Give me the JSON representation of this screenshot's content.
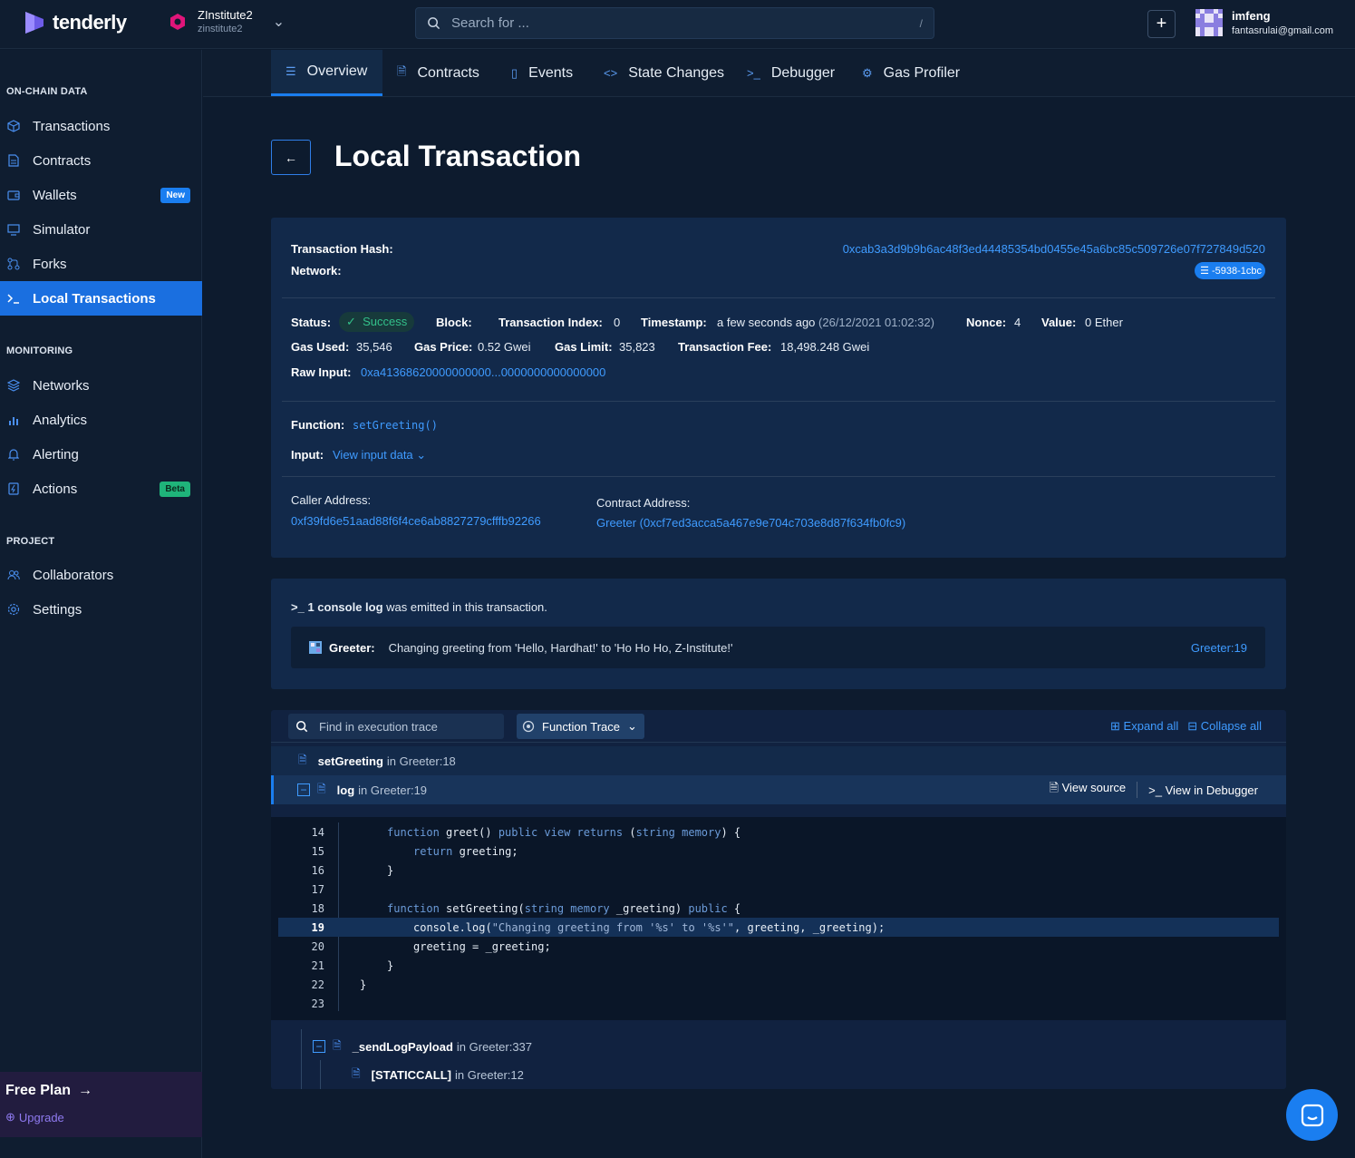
{
  "brand": {
    "name": "tenderly",
    "accent": "#1a7ef0"
  },
  "project": {
    "name": "ZInstitute2",
    "slug": "zinstitute2"
  },
  "search": {
    "placeholder": "Search for ...",
    "shortcut": "/"
  },
  "user": {
    "name": "imfeng",
    "email": "fantasrulai@gmail.com"
  },
  "sidebar": {
    "sections": [
      {
        "title": "ON-CHAIN DATA"
      },
      {
        "title": "MONITORING"
      },
      {
        "title": "PROJECT"
      }
    ],
    "items": [
      {
        "label": "Transactions",
        "icon": "cube-icon"
      },
      {
        "label": "Contracts",
        "icon": "document-icon"
      },
      {
        "label": "Wallets",
        "icon": "wallet-icon",
        "badge": "New"
      },
      {
        "label": "Simulator",
        "icon": "monitor-icon"
      },
      {
        "label": "Forks",
        "icon": "fork-icon"
      },
      {
        "label": "Local Transactions",
        "icon": "terminal-icon",
        "active": true
      },
      {
        "label": "Networks",
        "icon": "layers-icon"
      },
      {
        "label": "Analytics",
        "icon": "bar-chart-icon"
      },
      {
        "label": "Alerting",
        "icon": "bell-icon"
      },
      {
        "label": "Actions",
        "icon": "lightning-icon",
        "badge": "Beta"
      },
      {
        "label": "Collaborators",
        "icon": "users-icon"
      },
      {
        "label": "Settings",
        "icon": "gear-icon"
      }
    ],
    "plan": {
      "title": "Free Plan",
      "upgrade": "Upgrade"
    }
  },
  "tabs": [
    {
      "label": "Overview",
      "active": true
    },
    {
      "label": "Contracts"
    },
    {
      "label": "Events"
    },
    {
      "label": "State Changes"
    },
    {
      "label": "Debugger"
    },
    {
      "label": "Gas Profiler"
    }
  ],
  "page": {
    "title": "Local Transaction"
  },
  "tx": {
    "hash_label": "Transaction Hash:",
    "hash": "0xcab3a3d9b9b6ac48f3ed44485354bd0455e45a6bc85c509726e07f727849d520",
    "network_label": "Network:",
    "network": "-5938-1cbc",
    "status_label": "Status:",
    "status": "Success",
    "block_label": "Block:",
    "block": "",
    "index_label": "Transaction Index:",
    "index": "0",
    "timestamp_label": "Timestamp:",
    "timestamp": "a few seconds ago",
    "timestamp_full": "(26/12/2021 01:02:32)",
    "nonce_label": "Nonce:",
    "nonce": "4",
    "value_label": "Value:",
    "value": "0 Ether",
    "gas_used_label": "Gas Used:",
    "gas_used": "35,546",
    "gas_price_label": "Gas Price:",
    "gas_price": "0.52 Gwei",
    "gas_limit_label": "Gas Limit:",
    "gas_limit": "35,823",
    "fee_label": "Transaction Fee:",
    "fee": "18,498.248 Gwei",
    "raw_input_label": "Raw Input:",
    "raw_input": "0xa41368620000000000...0000000000000000",
    "function_label": "Function:",
    "function": "setGreeting()",
    "input_label": "Input:",
    "input_link": "View input data",
    "caller_label": "Caller Address:",
    "caller": "0xf39fd6e51aad88f6f4ce6ab8827279cfffb92266",
    "contract_label": "Contract Address:",
    "contract": "Greeter (0xcf7ed3acca5a467e9e704c703e8d87f634fb0fc9)"
  },
  "console": {
    "count_text": "1 console log",
    "suffix": " was emitted in this transaction.",
    "source": "Greeter:",
    "message": "Changing greeting from 'Hello, Hardhat!' to 'Ho Ho Ho, Z-Institute!'",
    "location": "Greeter:19"
  },
  "trace": {
    "search_placeholder": "Find in execution trace",
    "mode": "Function Trace",
    "expand_all": "Expand all",
    "collapse_all": "Collapse all",
    "view_source": "View source",
    "view_debugger": "View in Debugger",
    "rows": [
      {
        "name": "setGreeting",
        "loc": "in Greeter:18"
      },
      {
        "name": "log",
        "loc": "in Greeter:19"
      },
      {
        "name": "_sendLogPayload",
        "loc": "in Greeter:337"
      },
      {
        "name": "[STATICCALL]",
        "loc": "in Greeter:12"
      }
    ]
  },
  "code": {
    "lines": [
      {
        "n": "14"
      },
      {
        "n": "15"
      },
      {
        "n": "16"
      },
      {
        "n": "17"
      },
      {
        "n": "18"
      },
      {
        "n": "19",
        "highlight": true
      },
      {
        "n": "20"
      },
      {
        "n": "21"
      },
      {
        "n": "22"
      },
      {
        "n": "23"
      }
    ],
    "texts": {
      "l14a": "function",
      "l14b": " greet() ",
      "l14c": "public view returns",
      "l14d": " (",
      "l14e": "string memory",
      "l14f": ") {",
      "l15a": "return",
      "l15b": " greeting;",
      "l16": "}",
      "l18a": "function",
      "l18b": " setGreeting(",
      "l18c": "string memory",
      "l18d": " _greeting) ",
      "l18e": "public",
      "l18f": " {",
      "l19a": "console.log(",
      "l19b": "\"Changing greeting from '%s' to '%s'\"",
      "l19c": ", greeting, _greeting);",
      "l20": "greeting = _greeting;",
      "l21": "}",
      "l22": "}"
    }
  }
}
